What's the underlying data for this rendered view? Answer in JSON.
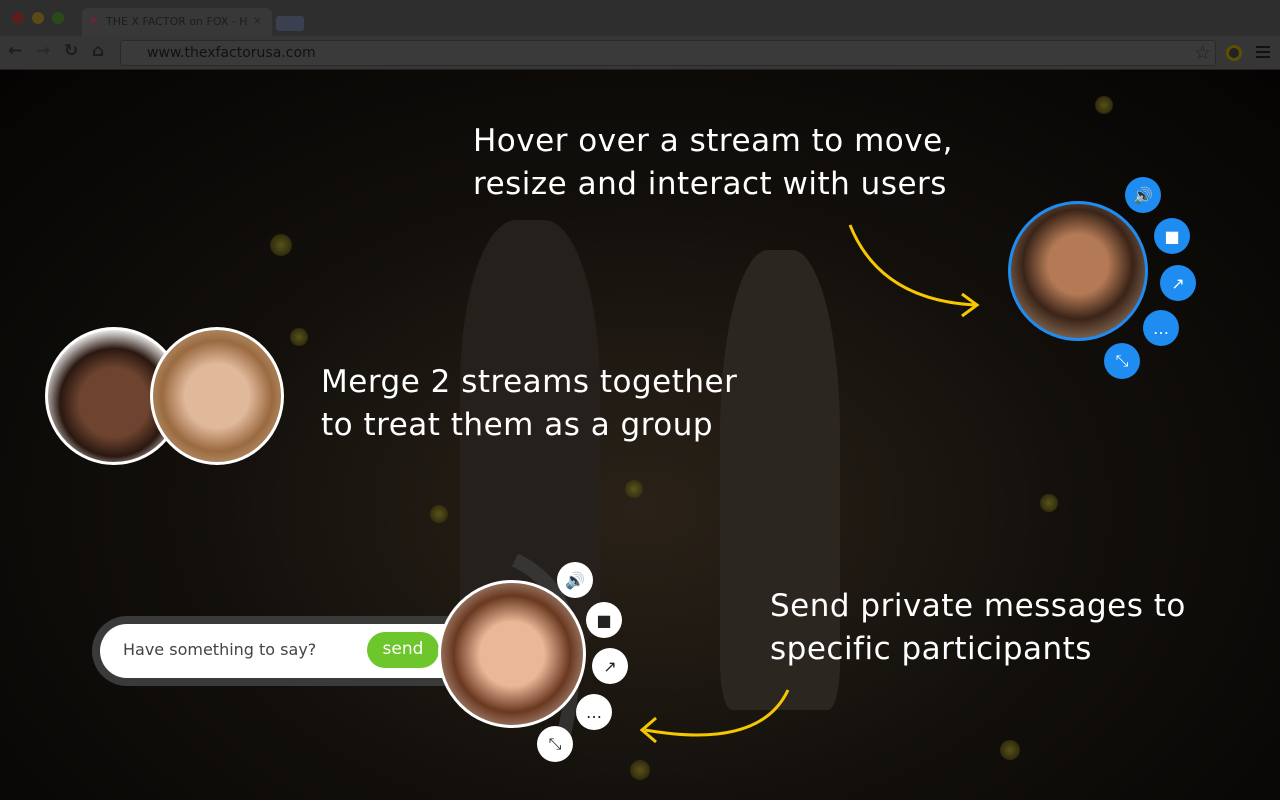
{
  "browser": {
    "tab_title": "THE X FACTOR on FOX - H",
    "url": "www.thexfactorusa.com",
    "colors": {
      "red": "#5a1e1c",
      "yellow": "#5a4a18",
      "green": "#2a4a1c"
    }
  },
  "captions": {
    "hover": [
      "Hover over a stream to move,",
      "resize and interact with users"
    ],
    "merge": [
      "Merge 2 streams together",
      "to treat them as a group"
    ],
    "private": [
      "Send private messages to",
      "specific participants"
    ]
  },
  "chat": {
    "placeholder": "Have something to say?",
    "send_label": "send"
  },
  "stream_controls": [
    "volume-icon",
    "video-icon",
    "share-icon",
    "chat-icon",
    "resize-icon"
  ],
  "colors": {
    "accent": "#1e8cf0",
    "send": "#6cc62c",
    "arrow": "#f5c800"
  }
}
